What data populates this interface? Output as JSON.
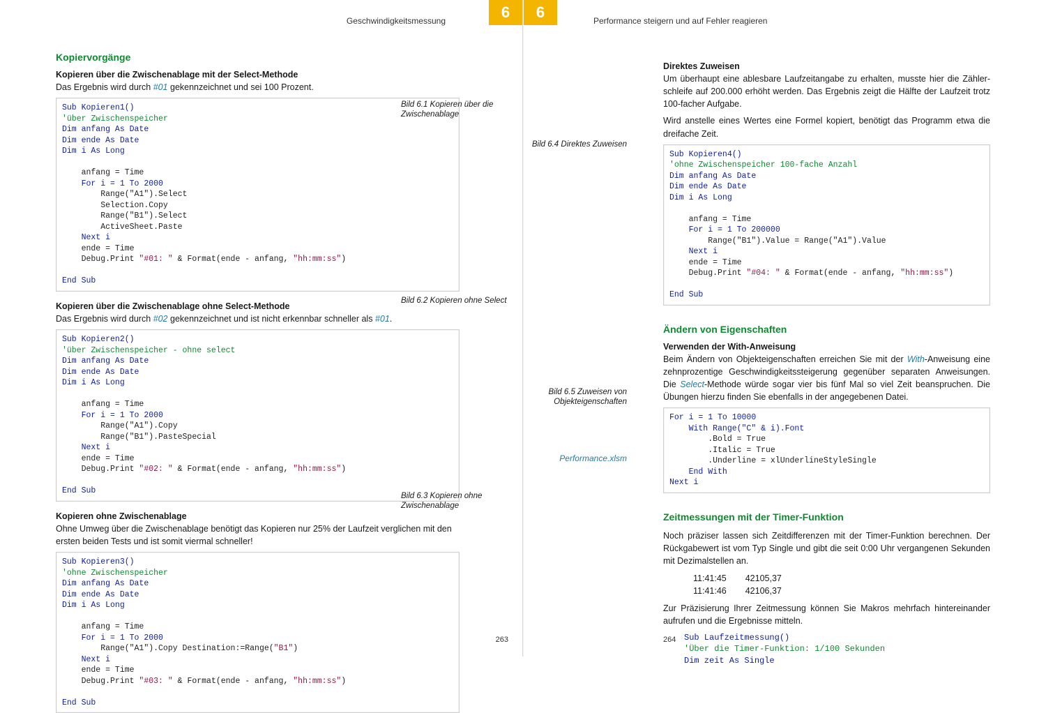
{
  "left": {
    "runhead": "Geschwindigkeitsmessung",
    "chapter": "6",
    "folio": "263",
    "h2": "Kopiervorgänge",
    "s1_head": "Kopieren über die Zwischenablage mit der Select-Methode",
    "s1_p_a": "Das Ergebnis wird durch ",
    "s1_ref": "#01",
    "s1_p_b": " gekennzeichnet und sei 100 Prozent.",
    "cap1": "Bild 6.1 Kopieren über die Zwischenablage",
    "s2_head": "Kopieren über die Zwischenablage ohne Select-Methode",
    "s2_p_a": "Das Ergebnis wird durch ",
    "s2_ref1": "#02",
    "s2_p_b": " gekennzeichnet und ist nicht erkennbar schneller als ",
    "s2_ref2": "#01",
    "s2_p_c": ".",
    "cap2": "Bild 6.2 Kopieren ohne Select",
    "s3_head": "Kopieren ohne Zwischenablage",
    "s3_p": "Ohne Umweg über die Zwischenablage benötigt das Kopieren nur 25% der Laufzeit verglichen mit den ersten beiden Tests und ist somit viermal schneller!",
    "cap3": "Bild 6.3 Kopieren ohne Zwischenablage"
  },
  "right": {
    "runhead": "Performance steigern und auf Fehler reagieren",
    "chapter": "6",
    "folio": "264",
    "s4_head": "Direktes Zuweisen",
    "s4_p1": "Um überhaupt eine ablesbare Laufzeitangabe zu erhalten, musste hier die Zähler­schleife auf 200.000 erhöht werden. Das Ergebnis zeigt die Hälfte der Laufzeit trotz 100-facher Aufgabe.",
    "s4_p2": "Wird anstelle eines Wertes eine Formel kopiert, benötigt das Programm etwa die drei­fache Zeit.",
    "cap4": "Bild 6.4 Direktes Zuweisen",
    "h2b": "Ändern von Eigenschaften",
    "s5_head": "Verwenden der With-Anweisung",
    "s5_p_a": "Beim Ändern von Objekteigenschaften erreichen Sie mit der ",
    "s5_em1": "With",
    "s5_p_b": "-Anweisung eine zehnprozentige Geschwindigkeitssteigerung gegenüber separaten Anweisungen. Die ",
    "s5_em2": "Select",
    "s5_p_c": "-Methode würde sogar vier bis fünf Mal so viel Zeit beanspruchen. Die Übungen hierzu finden Sie ebenfalls in der angegebenen Datei.",
    "cap5": "Bild 6.5 Zuweisen von Objekteigenschaften",
    "filelink": "Performance.xlsm",
    "h2c": "Zeitmessungen mit der Timer-Funktion",
    "s6_p1": "Noch präziser lassen sich Zeitdifferenzen mit der Timer-Funktion berechnen. Der Rück­gabewert ist vom Typ Single und gibt die seit 0:00 Uhr vergangenen Sekunden mit Dezimalstellen an.",
    "timer_rows": [
      {
        "t": "11:41:45",
        "v": "42105,37"
      },
      {
        "t": "11:41:46",
        "v": "42106,37"
      }
    ],
    "s6_p2": "Zur Präzisierung Ihrer Zeitmessung können Sie Makros mehrfach hintereinander auf­rufen und die Ergebnisse mitteln."
  },
  "code": {
    "k1_l1": "Sub Kopieren1()",
    "k1_l2": "'über Zwischenspeicher",
    "k1_l3": "Dim anfang As Date",
    "k1_l4": "Dim ende As Date",
    "k1_l5": "Dim i As Long",
    "k1_l6": "",
    "k1_l7": "    anfang = Time",
    "k1_l8": "    For i = 1 To 2000",
    "k1_l9": "        Range(\"A1\").Select",
    "k1_l10": "        Selection.Copy",
    "k1_l11": "        Range(\"B1\").Select",
    "k1_l12": "        ActiveSheet.Paste",
    "k1_l13": "    Next i",
    "k1_l14": "    ende = Time",
    "k1_l15a": "    Debug.Print ",
    "k1_l15b": "\"#01: \"",
    "k1_l15c": " & Format(ende - anfang, ",
    "k1_l15d": "\"hh:mm:ss\"",
    "k1_l15e": ")",
    "k1_l16": "",
    "k1_l17": "End Sub",
    "k2_l1": "Sub Kopieren2()",
    "k2_l2": "'über Zwischenspeicher - ohne select",
    "k2_l3": "Dim anfang As Date",
    "k2_l4": "Dim ende As Date",
    "k2_l5": "Dim i As Long",
    "k2_l6": "",
    "k2_l7": "    anfang = Time",
    "k2_l8": "    For i = 1 To 2000",
    "k2_l9": "        Range(\"A1\").Copy",
    "k2_l10": "        Range(\"B1\").PasteSpecial",
    "k2_l11": "    Next i",
    "k2_l12": "    ende = Time",
    "k2_l13a": "    Debug.Print ",
    "k2_l13b": "\"#02: \"",
    "k2_l13c": " & Format(ende - anfang, ",
    "k2_l13d": "\"hh:mm:ss\"",
    "k2_l13e": ")",
    "k2_l14": "",
    "k2_l15": "End Sub",
    "k3_l1": "Sub Kopieren3()",
    "k3_l2": "'ohne Zwischenspeicher",
    "k3_l3": "Dim anfang As Date",
    "k3_l4": "Dim ende As Date",
    "k3_l5": "Dim i As Long",
    "k3_l6": "",
    "k3_l7": "    anfang = Time",
    "k3_l8": "    For i = 1 To 2000",
    "k3_l9a": "        Range(\"A1\").Copy Destination:=Range(",
    "k3_l9b": "\"B1\"",
    "k3_l9c": ")",
    "k3_l10": "    Next i",
    "k3_l11": "    ende = Time",
    "k3_l12a": "    Debug.Print ",
    "k3_l12b": "\"#03: \"",
    "k3_l12c": " & Format(ende - anfang, ",
    "k3_l12d": "\"hh:mm:ss\"",
    "k3_l12e": ")",
    "k3_l13": "",
    "k3_l14": "End Sub",
    "k4_l1": "Sub Kopieren4()",
    "k4_l2": "'ohne Zwischenspeicher 100-fache Anzahl",
    "k4_l3": "Dim anfang As Date",
    "k4_l4": "Dim ende As Date",
    "k4_l5": "Dim i As Long",
    "k4_l6": "",
    "k4_l7": "    anfang = Time",
    "k4_l8": "    For i = 1 To 200000",
    "k4_l9": "        Range(\"B1\").Value = Range(\"A1\").Value",
    "k4_l10": "    Next i",
    "k4_l11": "    ende = Time",
    "k4_l12a": "    Debug.Print ",
    "k4_l12b": "\"#04: \"",
    "k4_l12c": " & Format(ende - anfang, ",
    "k4_l12d": "\"hh:mm:ss\"",
    "k4_l12e": ")",
    "k4_l13": "",
    "k4_l14": "End Sub",
    "k5_l1": "For i = 1 To 10000",
    "k5_l2": "    With Range(\"C\" & i).Font",
    "k5_l3": "        .Bold = True",
    "k5_l4": "        .Italic = True",
    "k5_l5": "        .Underline = xlUnderlineStyleSingle",
    "k5_l6": "    End With",
    "k5_l7": "Next i",
    "k6_l1": "Sub Laufzeitmessung()",
    "k6_l2": "'Über die Timer-Funktion: 1/100 Sekunden",
    "k6_l3": "Dim zeit As Single"
  }
}
